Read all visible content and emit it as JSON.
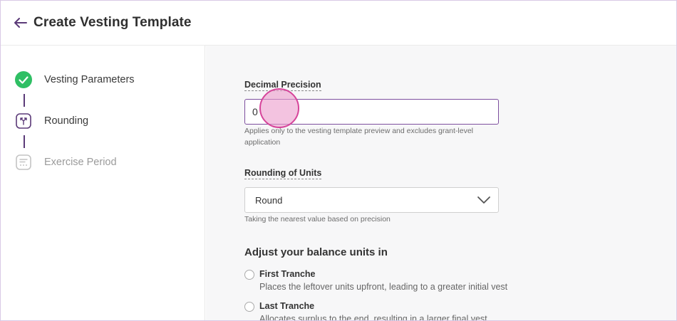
{
  "header": {
    "title": "Create Vesting Template",
    "back_icon": "arrow-left-icon",
    "accent_color": "#5b3a78"
  },
  "sidebar": {
    "steps": [
      {
        "label": "Vesting Parameters",
        "state": "completed",
        "icon": "check-circle-icon",
        "color": "#2fbf64"
      },
      {
        "label": "Rounding",
        "state": "active",
        "icon": "rounding-icon",
        "color": "#5b3a78"
      },
      {
        "label": "Exercise Period",
        "state": "pending",
        "icon": "calculator-icon",
        "color": "#b8b8b8"
      }
    ]
  },
  "form": {
    "decimal_precision": {
      "label": "Decimal Precision",
      "value": "0",
      "hint": "Applies only to the vesting template preview and excludes grant-level application"
    },
    "rounding_of_units": {
      "label": "Rounding of Units",
      "selected": "Round",
      "hint": "Taking the nearest value based on precision"
    },
    "balance_units": {
      "title": "Adjust your balance units in",
      "options": [
        {
          "label": "First Tranche",
          "description": "Places the leftover units upfront, leading to a greater initial vest",
          "selected": false
        },
        {
          "label": "Last Tranche",
          "description": "Allocates surplus to the end, resulting in a larger final vest",
          "selected": false
        }
      ]
    }
  }
}
